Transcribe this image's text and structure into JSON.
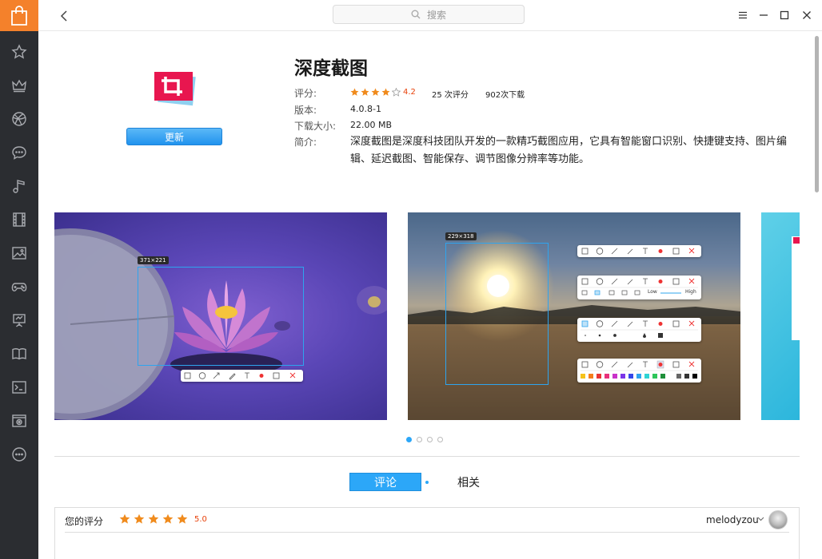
{
  "window": {
    "search_placeholder": "搜索"
  },
  "sidebar": {
    "items": [
      {
        "icon": "shopping-bag-icon",
        "label": ""
      },
      {
        "icon": "star-icon"
      },
      {
        "icon": "crown-icon"
      },
      {
        "icon": "globe-icon"
      },
      {
        "icon": "chat-icon"
      },
      {
        "icon": "music-icon"
      },
      {
        "icon": "film-icon"
      },
      {
        "icon": "image-icon"
      },
      {
        "icon": "gamepad-icon"
      },
      {
        "icon": "presentation-icon"
      },
      {
        "icon": "book-icon"
      },
      {
        "icon": "terminal-icon"
      },
      {
        "icon": "system-icon"
      },
      {
        "icon": "more-icon"
      }
    ]
  },
  "app": {
    "title": "深度截图",
    "update_label": "更新",
    "rating_label": "评分:",
    "rating_value": "4.2",
    "rating_fraction": 0.84,
    "rating_count": "25 次评分",
    "downloads": "902次下载",
    "version_label": "版本:",
    "version": "4.0.8-1",
    "size_label": "下载大小:",
    "size": "22.00 MB",
    "intro_label": "简介:",
    "description": "深度截图是深度科技团队开发的一款精巧截图应用，它具有智能窗口识别、快捷键支持、图片编辑、延迟截图、智能保存、调节图像分辨率等功能。"
  },
  "screenshots": {
    "shot1_size": "371×221",
    "shot2_size": "229×318",
    "shot2_low": "Low",
    "shot2_high": "High",
    "active_index": 0,
    "count": 4
  },
  "tabs": {
    "review": "评论",
    "related": "相关"
  },
  "my_rating": {
    "label": "您的评分",
    "score": "5.0",
    "username": "melodyzou"
  },
  "colors": {
    "accent": "#2ca7f8",
    "brand_orange": "#f4812b",
    "sidebar_bg": "#2b2d31",
    "star": "#f08b1d",
    "rating_text": "#e8420b"
  }
}
